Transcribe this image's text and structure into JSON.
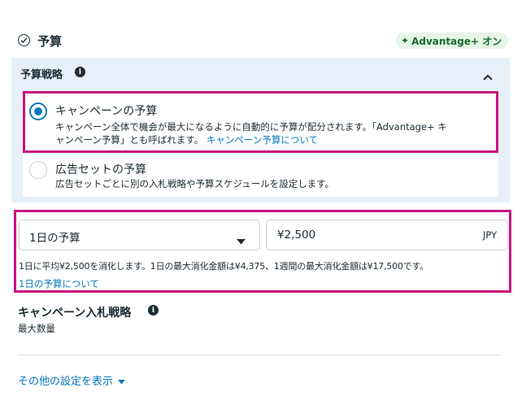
{
  "header": {
    "title": "予算",
    "advantage_badge": "Advantage+ オン"
  },
  "budget_strategy": {
    "title": "予算戦略",
    "options": [
      {
        "title": "キャンペーンの予算",
        "desc_line1": "キャンペーン全体で機会が最大になるように自動的に予算が配分されます。「Advantage+ キ",
        "desc_line2": "ャンペーン予算」とも呼ばれます。",
        "link": "キャンペーン予算について",
        "selected": true
      },
      {
        "title": "広告セットの予算",
        "desc_line1": "広告セットごとに別の入札戦略や予算スケジュールを設定します。",
        "selected": false
      }
    ]
  },
  "budget": {
    "type_label": "1日の予算",
    "amount": "¥2,500",
    "currency": "JPY",
    "note": "1日に平均¥2,500を消化します。1日の最大消化金額は¥4,375、1週間の最大消化金額は¥17,500です。",
    "link": "1日の予算について"
  },
  "bid_strategy": {
    "title": "キャンペーン入札戦略",
    "value": "最大数量"
  },
  "more_settings": "その他の設定を表示"
}
